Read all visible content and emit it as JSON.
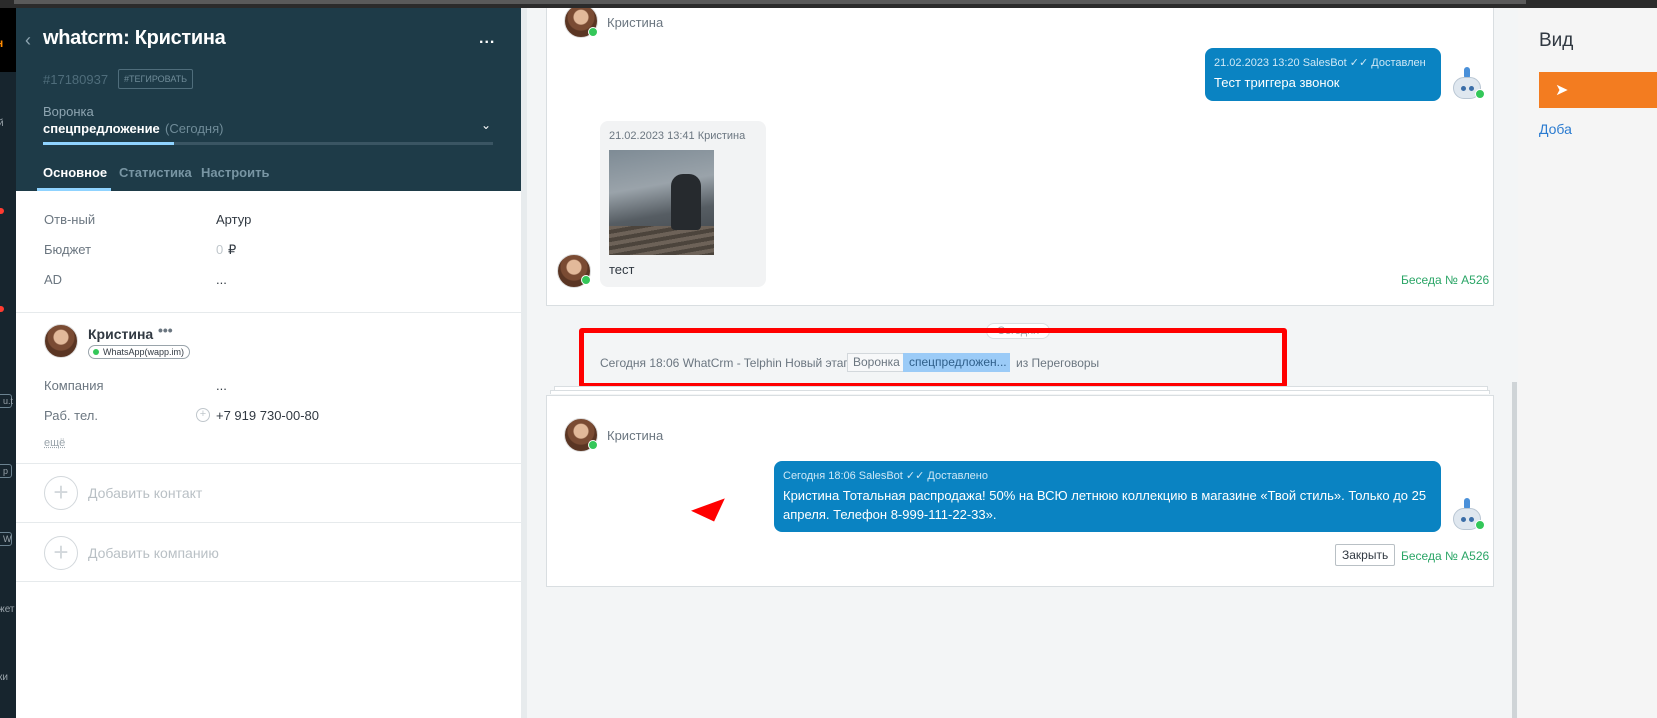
{
  "leftnav": {
    "logo_fragment": "н",
    "fragments": [
      "й",
      "u.t",
      "p",
      "W",
      "жет",
      "ки"
    ]
  },
  "lead": {
    "back_icon": "chevron-left-icon",
    "title": "whatcrm: Кристина",
    "more_label": "...",
    "id": "#17180937",
    "tag_label": "#ТЕГИРОВАТЬ",
    "pipeline_label": "Воронка",
    "stage": "спецпредложение",
    "stage_date": "(Сегодня)",
    "stage_progress": 0.29,
    "tabs": [
      {
        "label": "Основное",
        "active": true
      },
      {
        "label": "Статистика",
        "active": false
      },
      {
        "label": "Настроить",
        "active": false
      }
    ],
    "fields": [
      {
        "label": "Отв-ный",
        "value": "Артур"
      },
      {
        "label": "Бюджет",
        "value": "0",
        "unit": "₽"
      },
      {
        "label": "AD",
        "value": "..."
      }
    ]
  },
  "contact": {
    "name": "Кристина",
    "more_label": "•••",
    "badge": "WhatsApp(wapp.im)",
    "fields": [
      {
        "label": "Компания",
        "value": "..."
      },
      {
        "label": "Раб. тел.",
        "value": "+7 919 730-00-80"
      }
    ],
    "more_link": "ещё",
    "add_contact": "Добавить контакт",
    "add_company": "Добавить компанию"
  },
  "feed": {
    "chat1": {
      "client_name": "Кристина",
      "out_message": {
        "meta": "21.02.2023 13:20 SalesBot",
        "status": "Доставлен",
        "text": "Тест триггера звонок"
      },
      "in_message": {
        "meta": "21.02.2023 13:41 Кристина",
        "text": "тест"
      },
      "conversation_link": "Беседа № A526"
    },
    "day_label": "Сегодня",
    "event": {
      "prefix": "Сегодня 18:06 WhatCrm - Telphin Новый этап:",
      "pipeline": "Воронка",
      "stage": "спецпредложен...",
      "suffix": "из Переговоры"
    },
    "chat2": {
      "client_name": "Кристина",
      "out_message": {
        "meta": "Сегодня 18:06 SalesBot",
        "status": "Доставлено",
        "text": "Кристина Тотальная распродажа! 50% на ВСЮ летнюю коллекцию в магазине «Твой стиль». Только до 25 апреля. Телефон 8-999-111-22-33»."
      },
      "close_label": "Закрыть",
      "conversation_link": "Беседа № A526"
    }
  },
  "right_panel": {
    "title": "Вид",
    "button_icon": "send-icon",
    "link": "Доба"
  },
  "colors": {
    "header_bg": "#1e3b48",
    "bubble_blue": "#0a83c2",
    "highlight_red": "#ff0000",
    "accent_orange": "#f37c20",
    "link_green": "#2aa566"
  }
}
